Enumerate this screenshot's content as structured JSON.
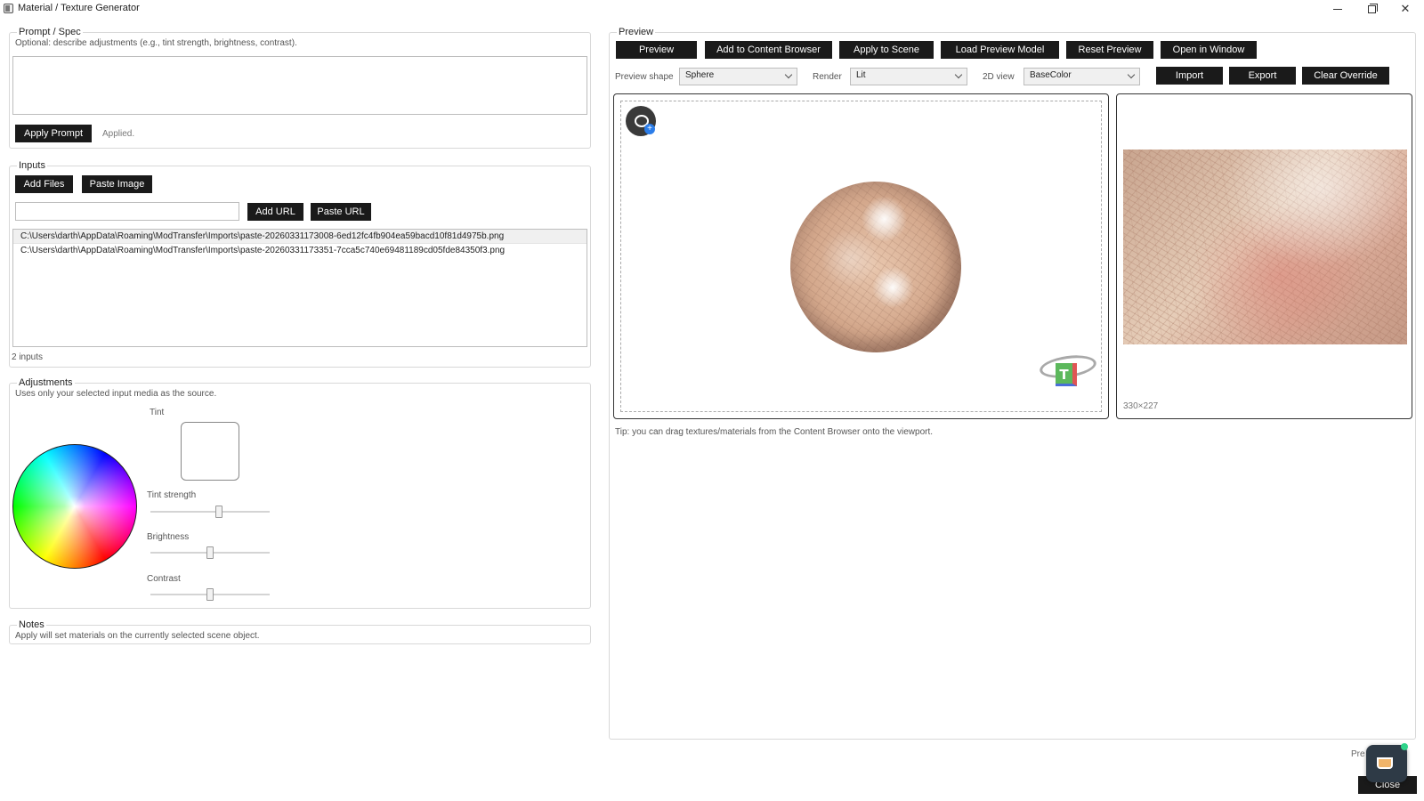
{
  "window": {
    "title": "Material / Texture Generator"
  },
  "prompt_spec": {
    "title": "Prompt / Spec",
    "hint": "Optional: describe adjustments (e.g., tint strength, brightness, contrast).",
    "value": "",
    "apply_label": "Apply Prompt",
    "status": "Applied."
  },
  "inputs": {
    "title": "Inputs",
    "add_files_label": "Add Files",
    "paste_image_label": "Paste Image",
    "url_value": "",
    "add_url_label": "Add URL",
    "paste_url_label": "Paste URL",
    "files": [
      "C:\\Users\\darth\\AppData\\Roaming\\ModTransfer\\Imports\\paste-20260331173008-6ed12fc4fb904ea59bacd10f81d4975b.png",
      "C:\\Users\\darth\\AppData\\Roaming\\ModTransfer\\Imports\\paste-20260331173351-7cca5c740e69481189cd05fde84350f3.png"
    ],
    "count_text": "2 inputs"
  },
  "adjustments": {
    "title": "Adjustments",
    "hint": "Uses only your selected input media as the source.",
    "tint_label": "Tint",
    "tint_color": "#ffffff",
    "tint_strength_label": "Tint strength",
    "tint_strength": 0.58,
    "brightness_label": "Brightness",
    "brightness": 0.5,
    "contrast_label": "Contrast",
    "contrast": 0.5
  },
  "notes": {
    "title": "Notes",
    "text": "Apply will set materials on the currently selected scene object."
  },
  "preview": {
    "title": "Preview",
    "buttons": {
      "preview": "Preview",
      "add_to_content_browser": "Add to Content Browser",
      "apply_to_scene": "Apply to Scene",
      "load_preview_model": "Load Preview Model",
      "reset_preview": "Reset Preview",
      "open_in_window": "Open in Window",
      "import": "Import",
      "export": "Export",
      "clear_override": "Clear Override"
    },
    "shape_label": "Preview shape",
    "shape_value": "Sphere",
    "render_label": "Render",
    "render_value": "Lit",
    "view2d_label": "2D view",
    "view2d_value": "BaseColor",
    "texture_size": "330×227",
    "tip": "Tip: you can drag textures/materials from the Content Browser onto the viewport.",
    "gizmo_glyph": "T"
  },
  "footer": {
    "prev_text": "Pre",
    "close_label": "Close"
  },
  "icons": {
    "camera": "camera-add-icon",
    "gizmo": "orientation-gizmo-icon",
    "floating": "coffee-cup-icon"
  }
}
